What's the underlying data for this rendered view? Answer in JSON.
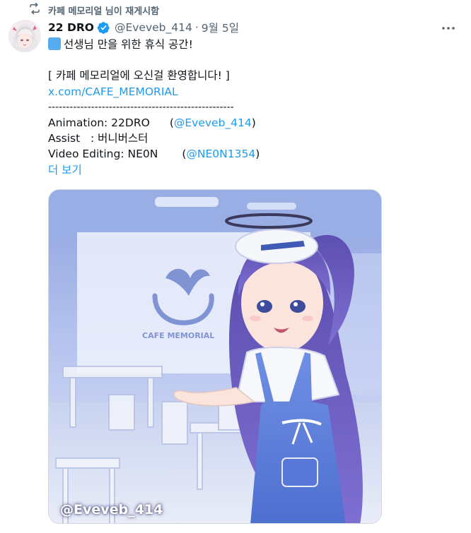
{
  "repost": {
    "text": "카페 메모리얼 님이 재게시함",
    "icon": "repost-icon"
  },
  "author": {
    "display_name": "22 DRO",
    "handle": "@Eveveb_414",
    "separator": "·",
    "date": "9월 5일",
    "verified_icon": "verified-badge-icon",
    "avatar": "avatar-image"
  },
  "more_icon": "more-options-icon",
  "tweet": {
    "line1_text": "선생님 만을 위한 휴식 공간!",
    "line3_text": "[ 카페 메모리얼에 오신걸 환영합니다! ]",
    "line4_link": "x.com/CAFE_MEMORIAL",
    "line5_separator": "----------------------------------------------------",
    "line6_label": "Animation: 22DRO",
    "line6_mention": "@Eveveb_414",
    "line6_close": ")",
    "line6_open": "(",
    "line7_text": "Assist   : 버니버스터",
    "line8_label": "Video Editing: NE0N",
    "line8_open": "(",
    "line8_mention": "@NE0N1354",
    "line8_close": ")",
    "show_more": "더 보기"
  },
  "media": {
    "watermark": "@Eveveb_414",
    "sign_text": "CAFE MEMORIAL",
    "colors": {
      "accent": "#1d9bf0",
      "muted": "#536471",
      "sky": "#7d9be0"
    }
  }
}
